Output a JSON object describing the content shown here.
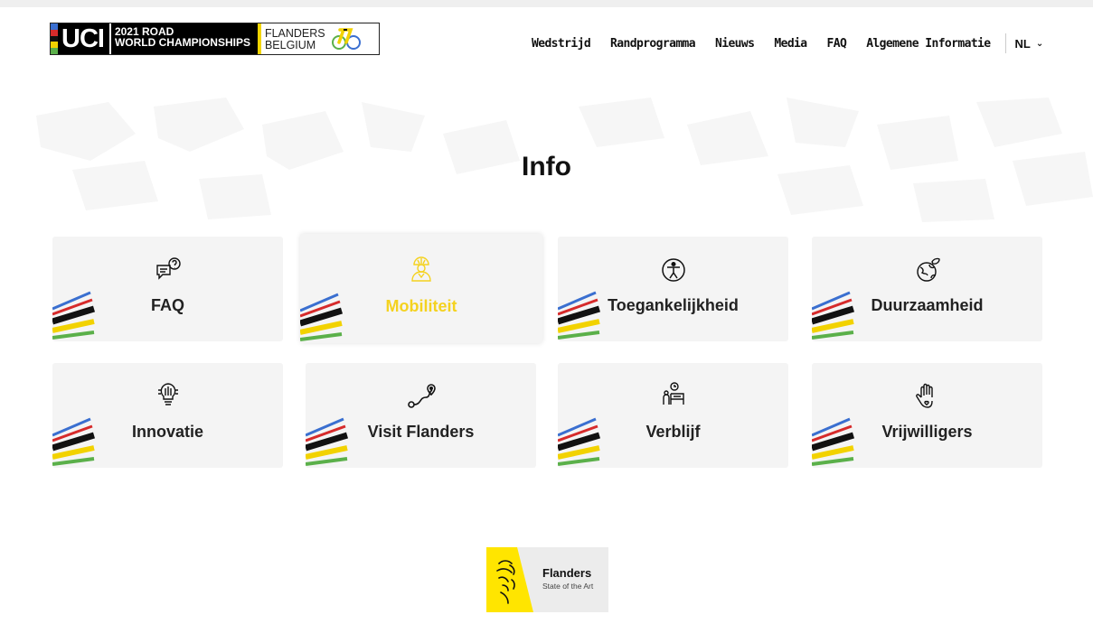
{
  "header": {
    "logo": {
      "uci": "UCI",
      "championship_line1": "2021 ROAD",
      "championship_line2": "WORLD CHAMPIONSHIPS",
      "host_line1": "FLANDERS",
      "host_line2": "BELGIUM"
    },
    "nav": [
      {
        "label": "Wedstrijd"
      },
      {
        "label": "Randprogramma"
      },
      {
        "label": "Nieuws"
      },
      {
        "label": "Media"
      },
      {
        "label": "FAQ"
      },
      {
        "label": "Algemene Informatie"
      }
    ],
    "language": "NL"
  },
  "main": {
    "title": "Info",
    "cards": [
      {
        "label": "FAQ",
        "icon": "faq-chat-icon",
        "active": false
      },
      {
        "label": "Mobiliteit",
        "icon": "cyclist-helmet-icon",
        "active": true
      },
      {
        "label": "Toegankelijkheid",
        "icon": "accessibility-icon",
        "active": false
      },
      {
        "label": "Duurzaamheid",
        "icon": "earth-leaf-icon",
        "active": false
      },
      {
        "label": "Innovatie",
        "icon": "lightbulb-icon",
        "active": false
      },
      {
        "label": "Visit Flanders",
        "icon": "route-pin-icon",
        "active": false
      },
      {
        "label": "Verblijf",
        "icon": "bed-person-icon",
        "active": false
      },
      {
        "label": "Vrijwilligers",
        "icon": "hand-heart-icon",
        "active": false
      }
    ]
  },
  "footer": {
    "logo_title": "Flanders",
    "logo_subtitle": "State of the Art"
  },
  "colors": {
    "active_label": "#f4d21f",
    "card_bg": "#f4f4f4",
    "rainbow": [
      "#3a6fd0",
      "#d62b2b",
      "#111111",
      "#f2d200",
      "#5bb04a"
    ]
  }
}
